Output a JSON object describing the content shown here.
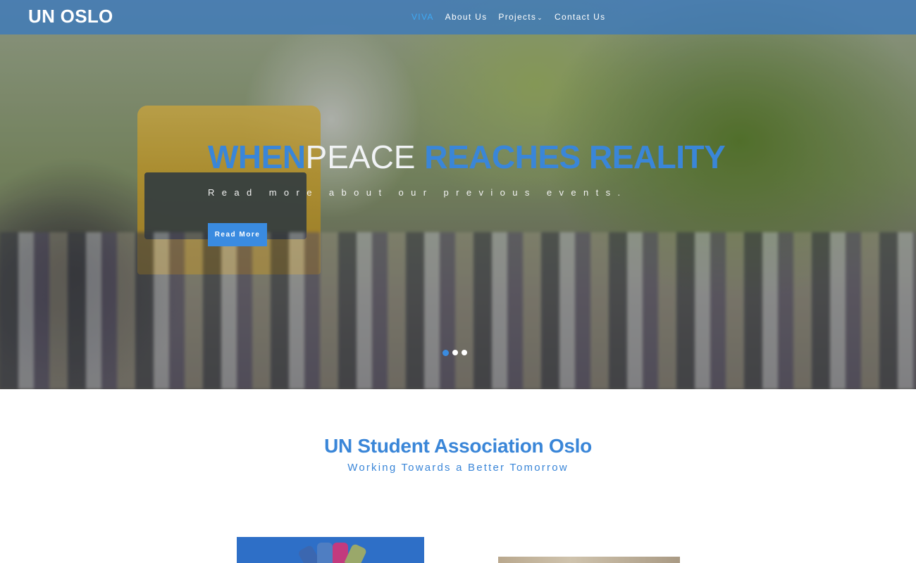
{
  "brand": {
    "name": "UN OSLO"
  },
  "nav": {
    "items": [
      {
        "label": "VIVA",
        "active": true
      },
      {
        "label": "About Us",
        "active": false
      },
      {
        "label": "Projects",
        "active": false,
        "has_dropdown": true
      },
      {
        "label": "Contact Us",
        "active": false
      }
    ],
    "dropdown_icon": "chevron-down-icon"
  },
  "hero": {
    "headline": {
      "part1": "WHEN",
      "part2": "PEACE ",
      "part3": "REACHES REALITY"
    },
    "subline": "Read more about our previous events.",
    "button_label": "Read More",
    "slides": {
      "count": 3,
      "active_index": 0
    }
  },
  "section": {
    "title": "UN Student Association Oslo",
    "subtitle": "Working Towards a Better Tomorrow"
  },
  "colors": {
    "accent": "#3a86d8",
    "nav_active": "#3fa9f5",
    "navbar_bg": "#3a78be"
  }
}
